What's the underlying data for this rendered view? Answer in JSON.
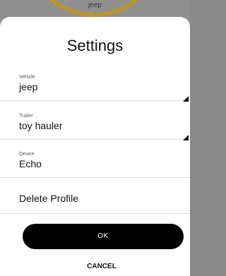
{
  "background": {
    "label": "jeep",
    "ring_color": "#b8932f"
  },
  "dialog": {
    "title": "Settings",
    "fields": {
      "vehicle": {
        "label": "Vehicle",
        "value": "jeep",
        "icon": "dropdown-corner-icon"
      },
      "trailer": {
        "label": "Trailer",
        "value": "toy hauler",
        "icon": "dropdown-corner-icon"
      },
      "device": {
        "label": "Device",
        "value": "Echo"
      }
    },
    "delete_label": "Delete Profile",
    "ok_label": "OK",
    "cancel_label": "CANCEL"
  }
}
